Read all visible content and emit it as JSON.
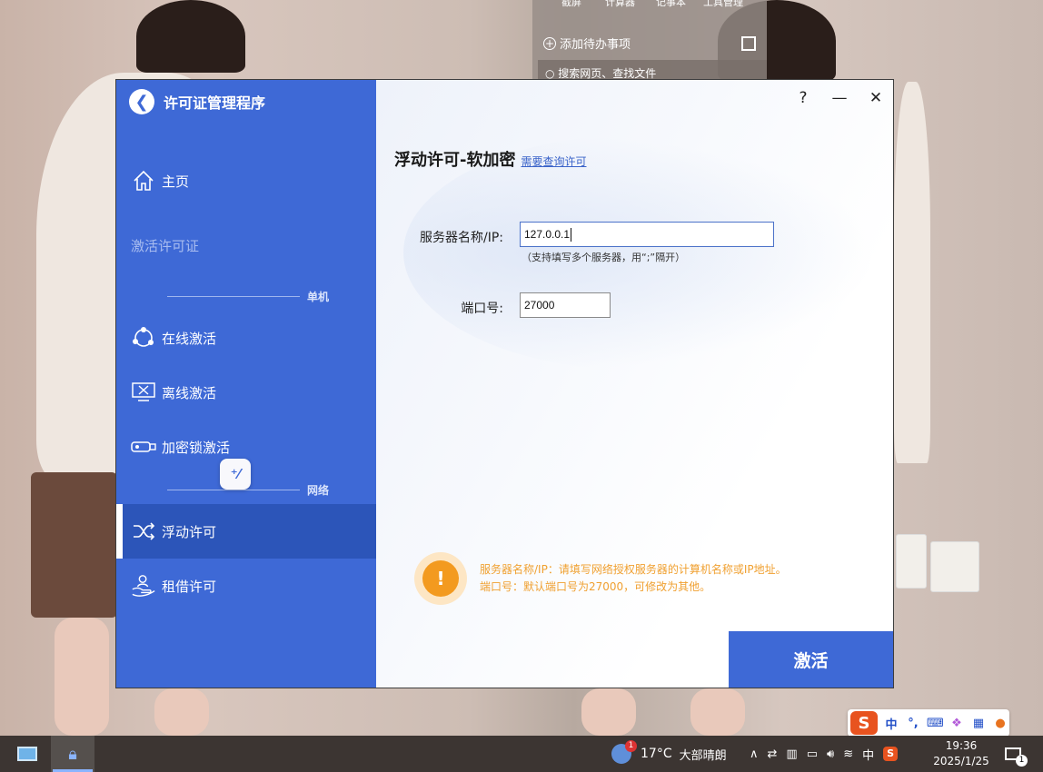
{
  "desktop": {
    "panel": {
      "top_items": [
        "截屏",
        "计算器",
        "记事本",
        "工具管理"
      ],
      "todo_label": "添加待办事项",
      "search_placeholder": "搜索网页、查找文件"
    }
  },
  "app": {
    "title": "许可证管理程序",
    "window_controls": {
      "help": "?",
      "minimize": "—",
      "close": "✕"
    },
    "sidebar": {
      "home": "主页",
      "activate_license": "激活许可证",
      "section_standalone": "单机",
      "online_activation": "在线激活",
      "offline_activation": "离线激活",
      "dongle_activation": "加密锁激活",
      "section_network": "网络",
      "floating_license": "浮动许可",
      "borrow_license": "租借许可"
    },
    "main": {
      "heading": "浮动许可-软加密",
      "query_link": "需要查询许可",
      "server_label": "服务器名称/IP:",
      "server_value": "127.0.0.1",
      "server_hint": "（支持填写多个服务器，用“;”隔开）",
      "port_label": "端口号:",
      "port_value": "27000",
      "tip_line1": "服务器名称/IP：请填写网络授权服务器的计算机名称或IP地址。",
      "tip_line2": "端口号：默认端口号为27000，可修改为其他。",
      "activate_button": "激活"
    },
    "colors": {
      "sidebar": "#3e69d6",
      "sidebar_active": "#2c55b9",
      "tip_orange": "#f39a1f",
      "link_blue": "#3a63c9"
    }
  },
  "ime": {
    "mode": "中",
    "punct": "°,",
    "logo": "S"
  },
  "taskbar": {
    "weather_badge": "1",
    "temperature": "17°C",
    "weather_text": "大部晴朗",
    "input_lang": "中",
    "time": "19:36",
    "date": "2025/1/25",
    "notification_count": "1"
  }
}
